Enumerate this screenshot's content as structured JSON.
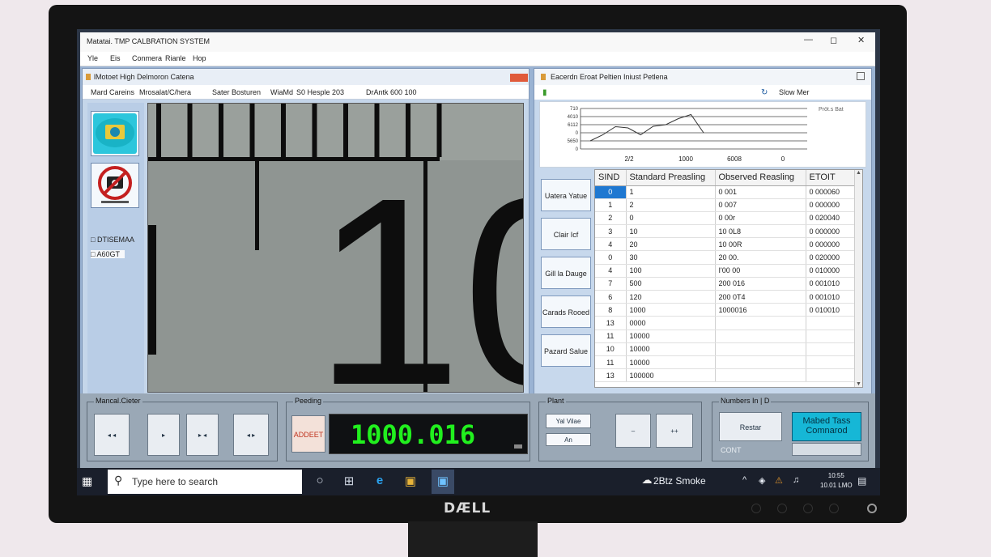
{
  "window": {
    "title": "Matatai. TMP CALBRATION SYSTEM"
  },
  "menu": [
    "Yle",
    "Eis",
    "Conmera",
    "Rianle",
    "Hop"
  ],
  "camera_panel": {
    "title": "lMotoet High Delmoron Catena",
    "toolbar": [
      "Mard Careins",
      "Mrosalat/C/hera",
      "Sater Bosturen",
      "WiaMd",
      "S0 Hesple 203",
      "DrAntk 600 100"
    ],
    "checkboxes": [
      "DTISEMAA",
      "A60GT"
    ],
    "view_number": "10"
  },
  "results_panel": {
    "title": "Eacerdn Eroat Peltien   Iniust   Petlena",
    "toolbar_right": "Slow Mer",
    "chart_legend": "Pröt.s Bat",
    "side_buttons": [
      "Uatera Yatue",
      "Clair Icf",
      "Gill la Dauge",
      "Carads Rooed",
      "Pazard Salue"
    ],
    "table": {
      "columns": [
        "SIND",
        "Standard Preasling",
        "Observed Reasling",
        "ETOIT"
      ],
      "rows": [
        [
          "0",
          "1",
          "0 001",
          "0 000060"
        ],
        [
          "1",
          "2",
          "0 007",
          "0 000000"
        ],
        [
          "2",
          "0",
          "0 00r",
          "0 020040"
        ],
        [
          "3",
          "10",
          "10 0L8",
          "0 000000"
        ],
        [
          "4",
          "20",
          "10 00R",
          "0 000000"
        ],
        [
          "0",
          "30",
          "20 00.",
          "0 020000"
        ],
        [
          "4",
          "100",
          "I'00 00",
          "0 010000"
        ],
        [
          "7",
          "500",
          "200 016",
          "0 001010"
        ],
        [
          "6",
          "120",
          "200 0T4",
          "0 001010"
        ],
        [
          "8",
          "1000",
          "1000016",
          "0 010010"
        ],
        [
          "13",
          "0000",
          "",
          ""
        ],
        [
          "11",
          "10000",
          "",
          ""
        ],
        [
          "10",
          "10000",
          "",
          ""
        ],
        [
          "11",
          "10000",
          "",
          ""
        ],
        [
          "13",
          "100000",
          "",
          ""
        ]
      ]
    }
  },
  "chart_data": {
    "type": "line",
    "ytick_labels": [
      "710",
      "4010",
      "6112",
      "0",
      "5650",
      "0"
    ],
    "xtick_labels": [
      "2/2",
      "1000",
      "6008",
      "0"
    ],
    "series": [
      {
        "values": [
          2,
          3.5,
          5.5,
          5.2,
          3.5,
          5.6,
          6,
          7.5,
          8.5,
          4
        ]
      }
    ]
  },
  "bottom": {
    "manual_label": "Mancal.Cieter",
    "manual_buttons": [
      "◂ ◂",
      "▸",
      "▸ ◂",
      "◂ ▸"
    ],
    "reading_label": "Peeding",
    "adjust_button": "ADDEET",
    "reading_value": "1000.016",
    "plant_label": "Plant",
    "plant_fields": [
      "Yal Vilae",
      "An"
    ],
    "plant_buttons": [
      "–",
      "++"
    ],
    "number_label": "Numbers In | D",
    "restar_button": "Restar",
    "mabed_button": "Mabed Tass Comnarod",
    "cont_label": "CONT"
  },
  "taskbar": {
    "search_placeholder": "Type here to search",
    "weather": "2Btz Smoke",
    "time": "10:55",
    "date": "10.01 LMO"
  },
  "monitor": {
    "brand": "DÆLL"
  },
  "colors": {
    "readout_green": "#21f01e",
    "accent_cyan": "#16b7d6",
    "selection_blue": "#1f78d1"
  }
}
